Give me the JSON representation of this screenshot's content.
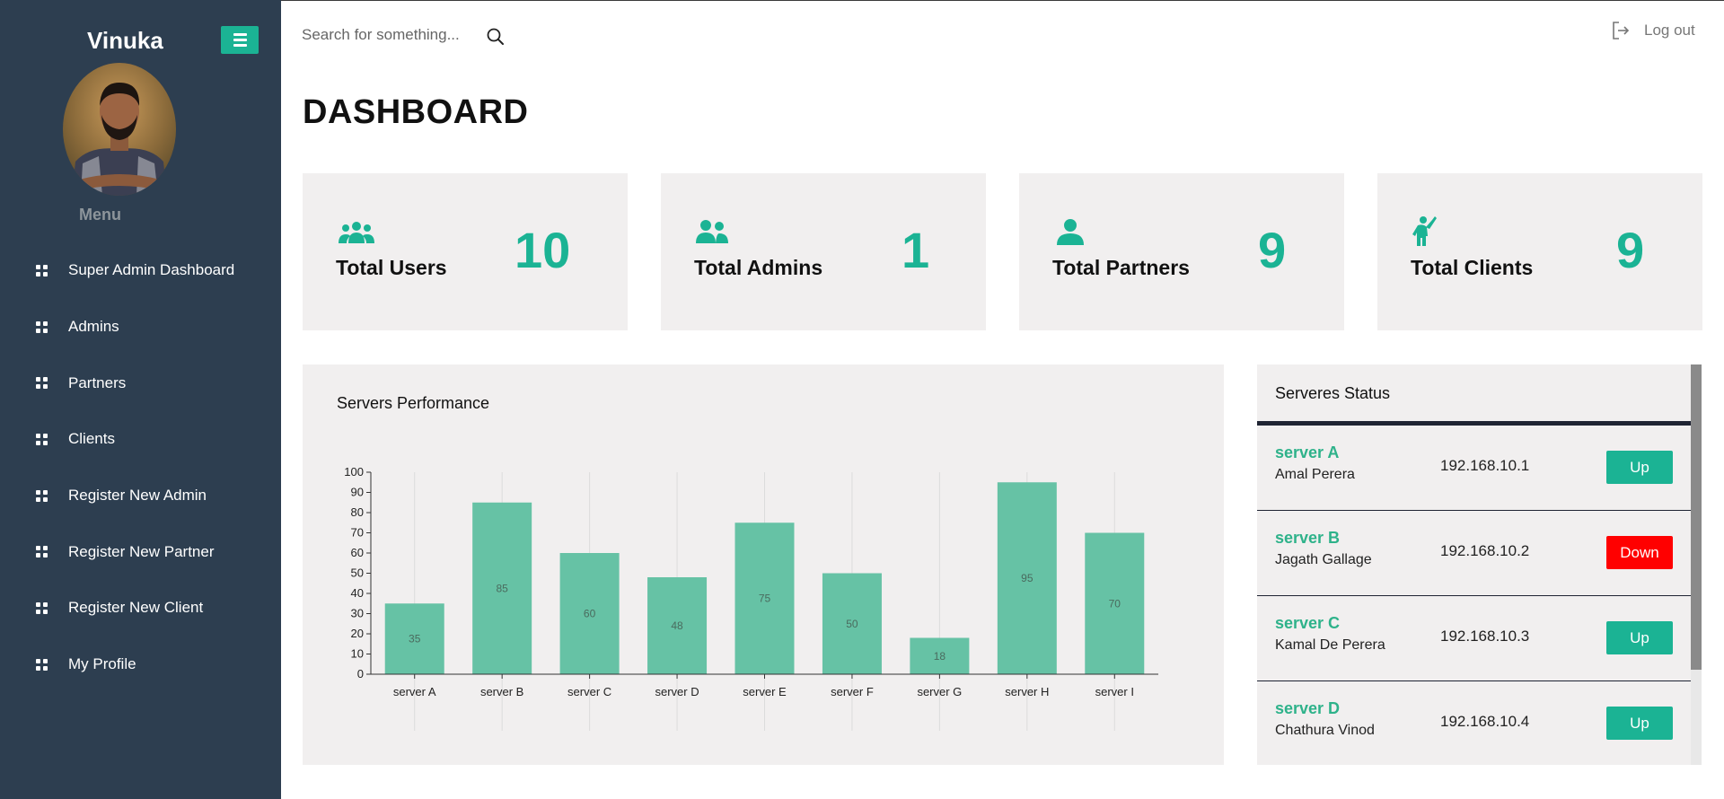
{
  "sidebar": {
    "brand": "Vinuka",
    "menu_label": "Menu",
    "items": [
      {
        "label": "Super Admin Dashboard",
        "icon": "grid-icon"
      },
      {
        "label": "Admins",
        "icon": "grid-icon"
      },
      {
        "label": "Partners",
        "icon": "grid-icon"
      },
      {
        "label": "Clients",
        "icon": "grid-icon"
      },
      {
        "label": "Register New Admin",
        "icon": "grid-icon"
      },
      {
        "label": "Register New Partner",
        "icon": "grid-icon"
      },
      {
        "label": "Register New Client",
        "icon": "grid-icon"
      },
      {
        "label": "My Profile",
        "icon": "grid-icon"
      }
    ]
  },
  "topbar": {
    "search_placeholder": "Search for something...",
    "logout_label": "Log out"
  },
  "page": {
    "title": "DASHBOARD"
  },
  "stats": [
    {
      "label": "Total Users",
      "value": "10",
      "icon": "users-group-icon"
    },
    {
      "label": "Total Admins",
      "value": "1",
      "icon": "admins-icon"
    },
    {
      "label": "Total Partners",
      "value": "9",
      "icon": "person-icon"
    },
    {
      "label": "Total Clients",
      "value": "9",
      "icon": "client-icon"
    }
  ],
  "chart_panel": {
    "title": "Servers Performance"
  },
  "chart_data": {
    "type": "bar",
    "categories": [
      "server A",
      "server B",
      "server C",
      "server D",
      "server E",
      "server F",
      "server G",
      "server H",
      "server I"
    ],
    "values": [
      35,
      85,
      60,
      48,
      75,
      50,
      18,
      95,
      70
    ],
    "ylim": [
      0,
      100
    ],
    "yticks": [
      0,
      10,
      20,
      30,
      40,
      50,
      60,
      70,
      80,
      90,
      100
    ],
    "grid": "vertical",
    "bar_color": "#66c2a5",
    "data_labels": true
  },
  "status_panel": {
    "title": "Serveres Status",
    "servers": [
      {
        "name": "server A",
        "owner": "Amal Perera",
        "ip": "192.168.10.1",
        "status": "Up"
      },
      {
        "name": "server B",
        "owner": "Jagath Gallage",
        "ip": "192.168.10.2",
        "status": "Down"
      },
      {
        "name": "server C",
        "owner": "Kamal De Perera",
        "ip": "192.168.10.3",
        "status": "Up"
      },
      {
        "name": "server D",
        "owner": "Chathura Vinod",
        "ip": "192.168.10.4",
        "status": "Up"
      }
    ]
  },
  "colors": {
    "sidebar_bg": "#2d3e50",
    "accent": "#1bb394",
    "card_bg": "#f1efef",
    "up": "#1bb394",
    "down": "#ff0000",
    "divider": "#1f2433"
  }
}
